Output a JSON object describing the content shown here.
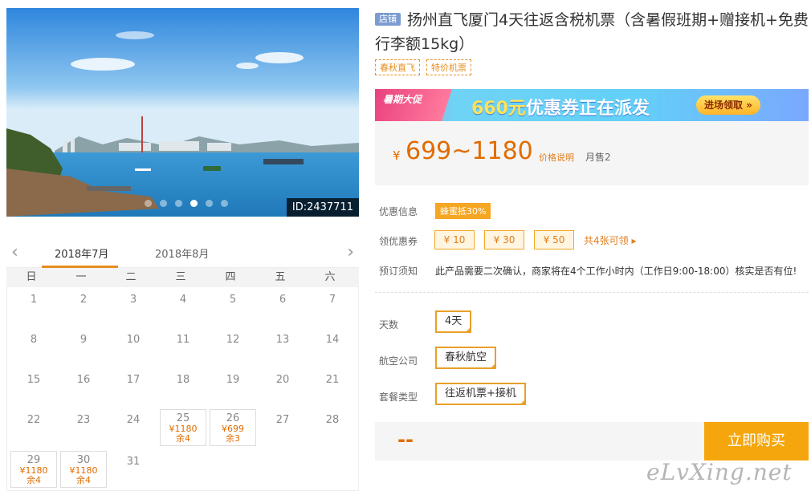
{
  "gallery": {
    "image_id": "ID:2437711",
    "dot_count": 6,
    "active_dot": 3
  },
  "calendar": {
    "months": [
      "2018年7月",
      "2018年8月"
    ],
    "active_month": 0,
    "weekdays": [
      "日",
      "一",
      "二",
      "三",
      "四",
      "五",
      "六"
    ],
    "weeks": [
      [
        {
          "d": "1"
        },
        {
          "d": "2"
        },
        {
          "d": "3"
        },
        {
          "d": "4"
        },
        {
          "d": "5"
        },
        {
          "d": "6"
        },
        {
          "d": "7"
        }
      ],
      [
        {
          "d": "8"
        },
        {
          "d": "9"
        },
        {
          "d": "10"
        },
        {
          "d": "11"
        },
        {
          "d": "12"
        },
        {
          "d": "13"
        },
        {
          "d": "14"
        }
      ],
      [
        {
          "d": "15"
        },
        {
          "d": "16"
        },
        {
          "d": "17"
        },
        {
          "d": "18"
        },
        {
          "d": "19"
        },
        {
          "d": "20"
        },
        {
          "d": "21"
        }
      ],
      [
        {
          "d": "22"
        },
        {
          "d": "23"
        },
        {
          "d": "24"
        },
        {
          "d": "25",
          "price": "¥1180",
          "remain": "余4"
        },
        {
          "d": "26",
          "price": "¥699",
          "remain": "余3"
        },
        {
          "d": "27"
        },
        {
          "d": "28"
        }
      ],
      [
        {
          "d": "29",
          "price": "¥1180",
          "remain": "余4"
        },
        {
          "d": "30",
          "price": "¥1180",
          "remain": "余4"
        },
        {
          "d": "31"
        }
      ]
    ]
  },
  "product": {
    "store_tag": "店铺",
    "title": "扬州直飞厦门4天往返含税机票（含暑假班期+赠接机+免费行李额15kg）",
    "tags": [
      "春秋直飞",
      "特价机票"
    ]
  },
  "banner": {
    "ribbon": "暑期大促",
    "offer_amount": "660元",
    "offer_text": "优惠券正在派发",
    "claim": "进场领取 »"
  },
  "price": {
    "currency": "¥",
    "range": "699~1180",
    "note": "价格说明",
    "sold": "月售2"
  },
  "info": {
    "promo_label": "优惠信息",
    "promo_badge": "蜂蜜抵30%",
    "coupon_label": "领优惠券",
    "coupons": [
      "¥ 10",
      "¥ 30",
      "¥ 50"
    ],
    "coupon_more": "共4张可领 ▸",
    "booking_label": "预订须知",
    "booking_text": "此产品需要二次确认，商家将在4个工作小时内（工作日9:00-18:00）核实是否有位!"
  },
  "options": {
    "days_label": "天数",
    "days_value": "4天",
    "airline_label": "航空公司",
    "airline_value": "春秋航空",
    "package_label": "套餐类型",
    "package_value": "往返机票+接机"
  },
  "buy": {
    "total": "--",
    "button": "立即购买"
  },
  "watermark": "eLvXing.net",
  "colors": {
    "accent": "#e06c00",
    "button": "#f5a60c",
    "store_tag": "#7c9cd1"
  }
}
